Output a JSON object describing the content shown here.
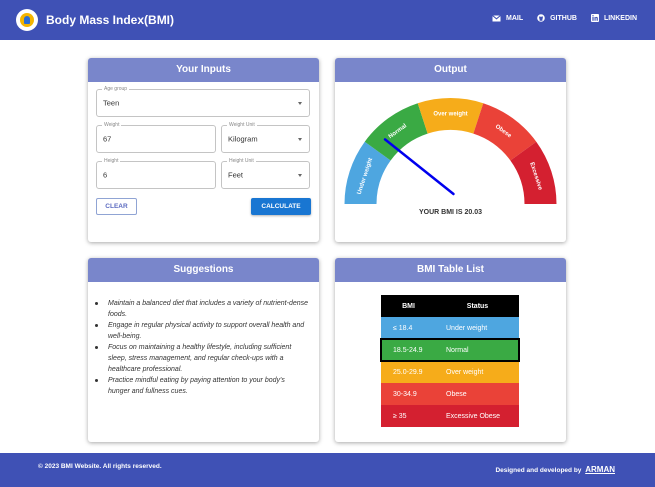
{
  "app": {
    "title": "Body Mass Index(BMI)",
    "brand_color": "#3f51b5"
  },
  "nav": {
    "mail": "MAIL",
    "github": "GITHUB",
    "linkedin": "LINKEDIN"
  },
  "inputs": {
    "title": "Your Inputs",
    "age_group": {
      "label": "Age group",
      "value": "Teen"
    },
    "weight": {
      "label": "Weight",
      "value": "67"
    },
    "weight_unit": {
      "label": "Weight Unit",
      "value": "Kilogram"
    },
    "height": {
      "label": "Height",
      "value": "6"
    },
    "height_unit": {
      "label": "Height Unit",
      "value": "Feet"
    },
    "clear_label": "CLEAR",
    "calculate_label": "CALCULATE"
  },
  "output": {
    "title": "Output",
    "result_text": "YOUR BMI IS 20.03",
    "bmi_value": 20.03,
    "gauge_segments": [
      {
        "label": "Under weight",
        "color": "#4ea6e0"
      },
      {
        "label": "Normal",
        "color": "#3aaa44"
      },
      {
        "label": "Over weight",
        "color": "#f6ac1a"
      },
      {
        "label": "Obese",
        "color": "#ea4238"
      },
      {
        "label": "Excessive",
        "color": "#d42030"
      }
    ],
    "needle_color": "#0000ee"
  },
  "suggestions": {
    "title": "Suggestions",
    "items": [
      "Maintain a balanced diet that includes a variety of nutrient-dense foods.",
      "Engage in regular physical activity to support overall health and well-being.",
      "Focus on maintaining a healthy lifestyle, including sufficient sleep, stress management, and regular check-ups with a healthcare professional.",
      "Practice mindful eating by paying attention to your body's hunger and fullness cues."
    ]
  },
  "bmi_table": {
    "title": "BMI Table List",
    "headers": [
      "BMI",
      "Status"
    ],
    "rows": [
      {
        "range": "≤ 18.4",
        "status": "Under weight",
        "color": "#4ea6e0"
      },
      {
        "range": "18.5-24.9",
        "status": "Normal",
        "color": "#3aaa44"
      },
      {
        "range": "25.0-29.9",
        "status": "Over weight",
        "color": "#f6ac1a"
      },
      {
        "range": "30-34.9",
        "status": "Obese",
        "color": "#ea4238"
      },
      {
        "range": "≥ 35",
        "status": "Excessive Obese",
        "color": "#d42030"
      }
    ]
  },
  "footer": {
    "copyright": "© 2023 BMI Website. All rights reserved.",
    "credit_prefix": "Designed and developed by",
    "credit_name": "ARMAN"
  }
}
